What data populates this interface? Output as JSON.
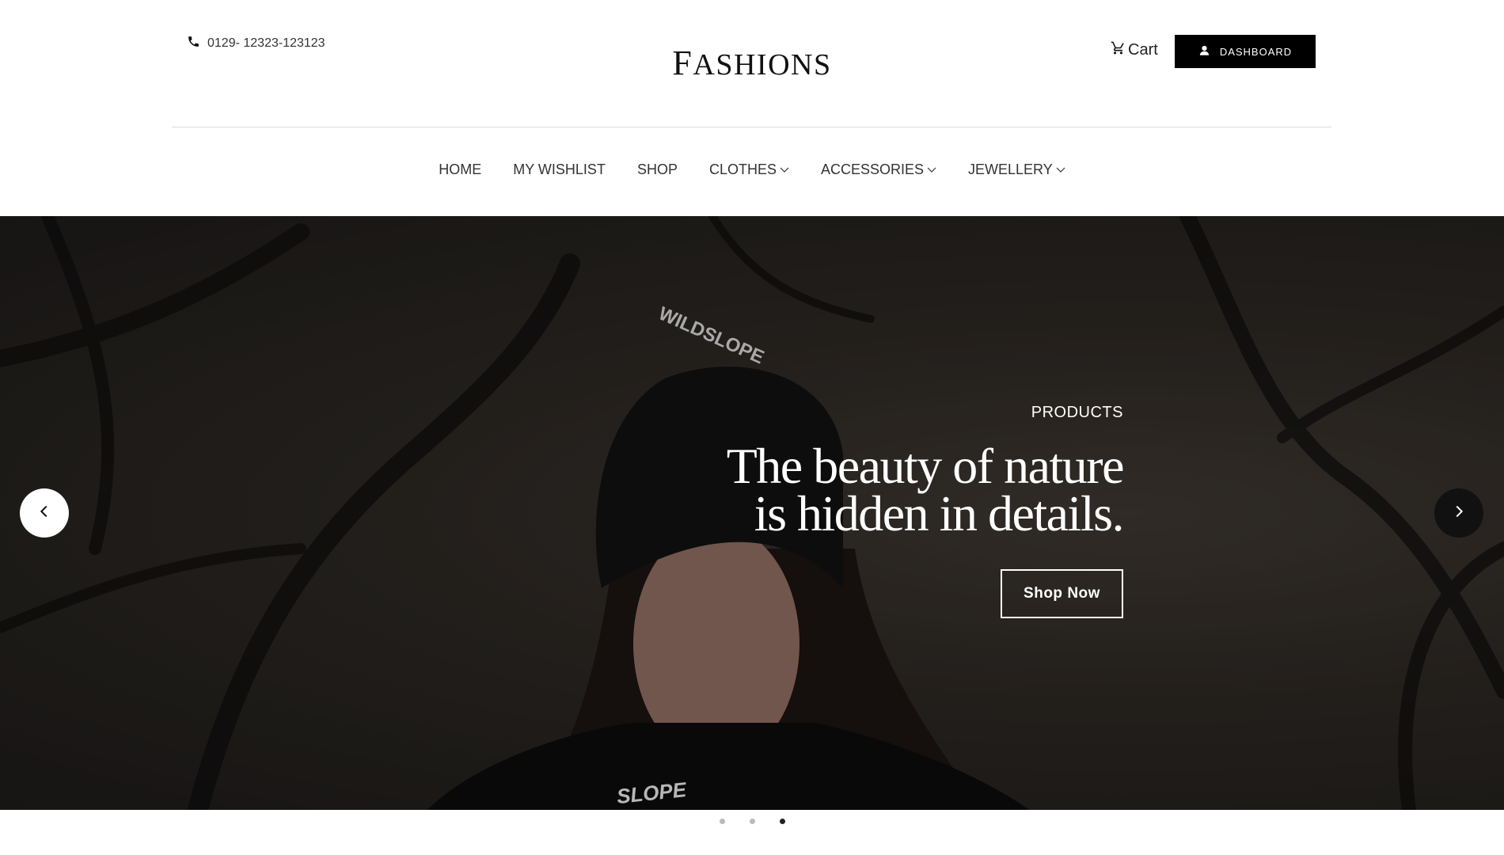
{
  "header": {
    "phone": "0129- 12323-123123",
    "logo": {
      "first": "F",
      "rest": "ASHIONS"
    },
    "cart_label": "Cart",
    "dashboard_label": "DASHBOARD"
  },
  "nav": {
    "items": [
      {
        "label": "HOME",
        "dropdown": false
      },
      {
        "label": "MY WISHLIST",
        "dropdown": false
      },
      {
        "label": "SHOP",
        "dropdown": false
      },
      {
        "label": "CLOTHES",
        "dropdown": true
      },
      {
        "label": "ACCESSORIES",
        "dropdown": true
      },
      {
        "label": "JEWELLERY",
        "dropdown": true
      }
    ]
  },
  "hero": {
    "kicker": "PRODUCTS",
    "headline_line1": "The beauty of nature",
    "headline_line2": "is hidden in details.",
    "cta_label": "Shop Now",
    "beanie_text": "WILDSLOPE",
    "shirt_text": "SLOPE"
  },
  "carousel": {
    "slide_count": 3,
    "active_index": 2
  },
  "colors": {
    "accent": "#000000",
    "hero_dark": "#1c1a18",
    "text": "#111111"
  }
}
